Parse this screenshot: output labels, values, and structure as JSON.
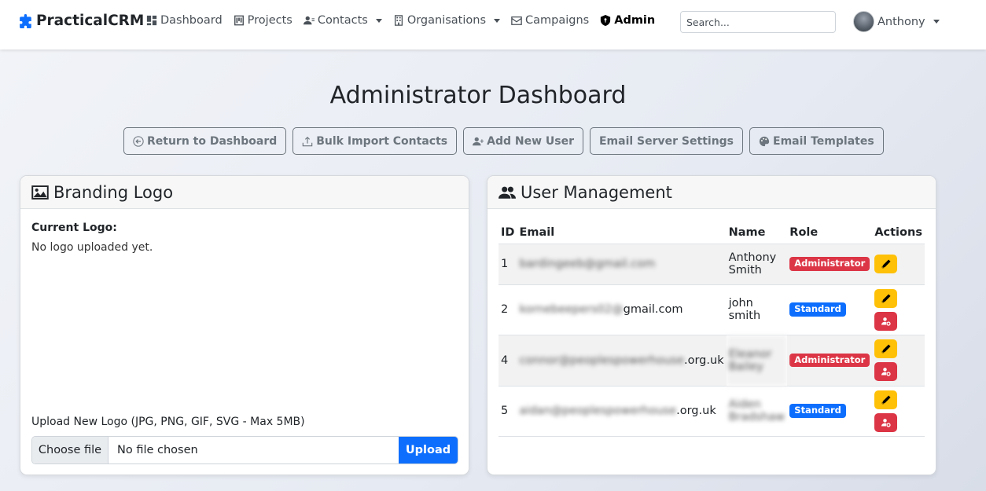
{
  "brand": {
    "name": "PracticalCRM",
    "icon": "puzzle-icon",
    "color": "#0d6efd"
  },
  "nav": [
    {
      "label": "Dashboard",
      "icon": "dashboard-icon",
      "dropdown": false
    },
    {
      "label": "Projects",
      "icon": "kanban-icon",
      "dropdown": false
    },
    {
      "label": "Contacts",
      "icon": "contacts-icon",
      "dropdown": true
    },
    {
      "label": "Organisations",
      "icon": "building-icon",
      "dropdown": true
    },
    {
      "label": "Campaigns",
      "icon": "envelope-icon",
      "dropdown": false
    },
    {
      "label": "Admin",
      "icon": "shield-icon",
      "dropdown": false,
      "active": true
    }
  ],
  "search": {
    "placeholder": "Search..."
  },
  "user": {
    "name": "Anthony"
  },
  "page": {
    "title": "Administrator Dashboard"
  },
  "actions": [
    {
      "label": "Return to Dashboard",
      "icon": "arrow-left-circle-icon"
    },
    {
      "label": "Bulk Import Contacts",
      "icon": "upload-icon"
    },
    {
      "label": "Add New User",
      "icon": "user-plus-icon"
    },
    {
      "label": "Email Server Settings",
      "icon": ""
    },
    {
      "label": "Email Templates",
      "icon": "palette-icon"
    }
  ],
  "branding": {
    "title": "Branding Logo",
    "current_label": "Current Logo:",
    "current_status": "No logo uploaded yet.",
    "upload_label": "Upload New Logo (JPG, PNG, GIF, SVG - Max 5MB)",
    "choose_label": "Choose file",
    "file_status": "No file chosen",
    "upload_button": "Upload"
  },
  "users": {
    "title": "User Management",
    "columns": [
      "ID",
      "Email",
      "Name",
      "Role",
      "Actions"
    ],
    "rows": [
      {
        "id": "1",
        "email_hidden": "bardingeeb@gmail.com",
        "email_visible": "",
        "name": "Anthony Smith",
        "name_blurred": false,
        "role": "Administrator",
        "role_color": "#dc3545",
        "can_delete": false
      },
      {
        "id": "2",
        "email_hidden": "kornebeepers02@",
        "email_visible": "gmail.com",
        "name": "john smith",
        "name_blurred": false,
        "role": "Standard",
        "role_color": "#0d6efd",
        "can_delete": true
      },
      {
        "id": "4",
        "email_hidden": "connor@peoplespowerhouse",
        "email_visible": ".org.uk",
        "name": "Eleanor Bailey",
        "name_blurred": true,
        "role": "Administrator",
        "role_color": "#dc3545",
        "can_delete": true
      },
      {
        "id": "5",
        "email_hidden": "aidan@peoplespowerhouse",
        "email_visible": ".org.uk",
        "name": "Aiden Bradshaw",
        "name_blurred": true,
        "role": "Standard",
        "role_color": "#0d6efd",
        "can_delete": true
      }
    ]
  }
}
